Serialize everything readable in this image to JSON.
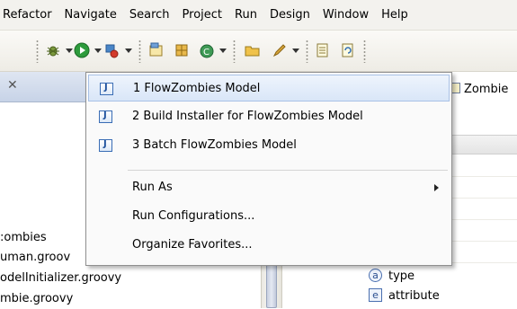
{
  "menubar": {
    "items": [
      "Refactor",
      "Navigate",
      "Search",
      "Project",
      "Run",
      "Design",
      "Window",
      "Help"
    ]
  },
  "toolbar": {
    "icons": [
      "debug-icon",
      "run-icon",
      "external-tools-icon",
      "new-type-icon",
      "new-class-icon",
      "new-generic-icon",
      "open-folder-icon",
      "pen-icon",
      "outline-icon",
      "refresh-icon"
    ]
  },
  "package_explorer": {
    "tree_lines": [
      ":ombies",
      "uman.groov",
      "odelInitializer.groovy",
      "mbie.groovy"
    ]
  },
  "editor_area": {
    "tab_label": "Zombie",
    "attribute_rows": [
      {
        "badge": "a",
        "label": "type"
      },
      {
        "badge": "e",
        "label": "attribute"
      }
    ]
  },
  "run_menu": {
    "favorites": [
      {
        "label": "1 FlowZombies Model",
        "selected": true
      },
      {
        "label": "2 Build Installer for FlowZombies Model",
        "selected": false
      },
      {
        "label": "3 Batch FlowZombies Model",
        "selected": false
      }
    ],
    "run_as_label": "Run As",
    "run_configurations_label": "Run Configurations...",
    "organize_favorites_label": "Organize Favorites...",
    "java_icon_glyph": "J"
  }
}
